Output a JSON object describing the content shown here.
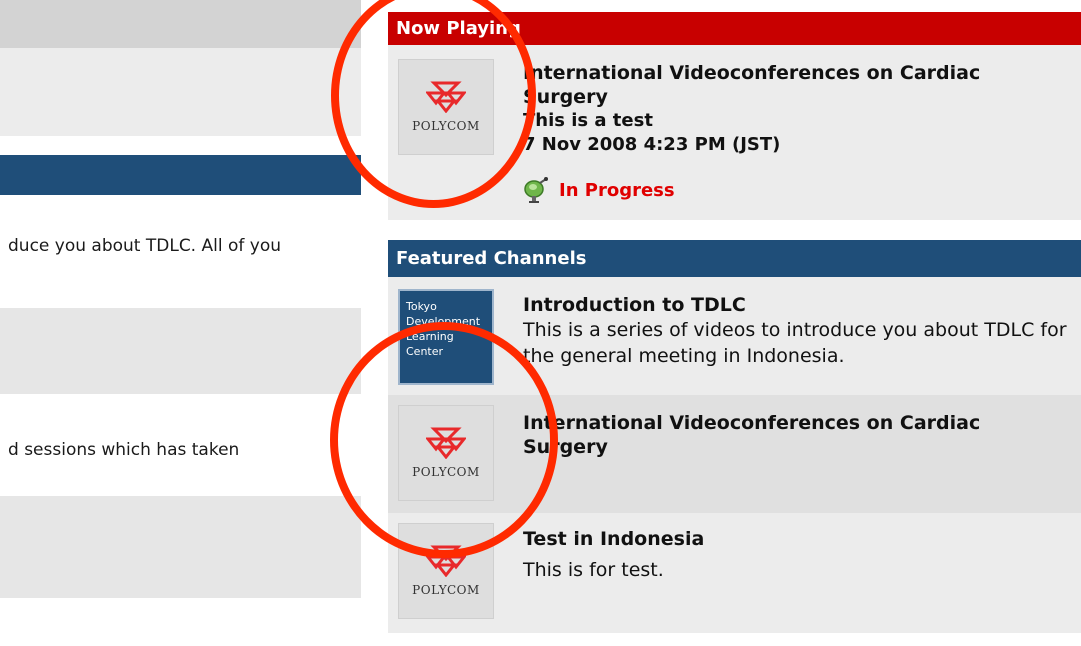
{
  "left": {
    "text_row_1": "duce you about TDLC. All of you",
    "text_row_2": "d sessions which has taken"
  },
  "now_playing": {
    "header": "Now Playing",
    "thumb_brand": "POLYCOM",
    "title": "International Videoconferences on Cardiac Surgery",
    "subtitle": "This is a test",
    "datetime": "7 Nov 2008 4:23 PM (JST)",
    "status": "In Progress",
    "status_color": "#e00000",
    "status_icon": "satellite-dish-icon"
  },
  "featured": {
    "header": "Featured Channels",
    "items": [
      {
        "thumb_lines": [
          "Tokyo",
          "Development",
          "Learning",
          "Center"
        ],
        "title": "Introduction to TDLC",
        "description": "This is a series of videos to introduce you about TDLC for the general meeting in Indonesia."
      },
      {
        "thumb_brand": "POLYCOM",
        "title": "International Videoconferences on Cardiac Surgery",
        "description": ""
      },
      {
        "thumb_brand": "POLYCOM",
        "title": "Test in Indonesia",
        "description": "This is for test."
      }
    ]
  },
  "colors": {
    "now_playing_header": "#c80000",
    "featured_header": "#1f4e79",
    "annotation_ring": "#ff2a00"
  }
}
